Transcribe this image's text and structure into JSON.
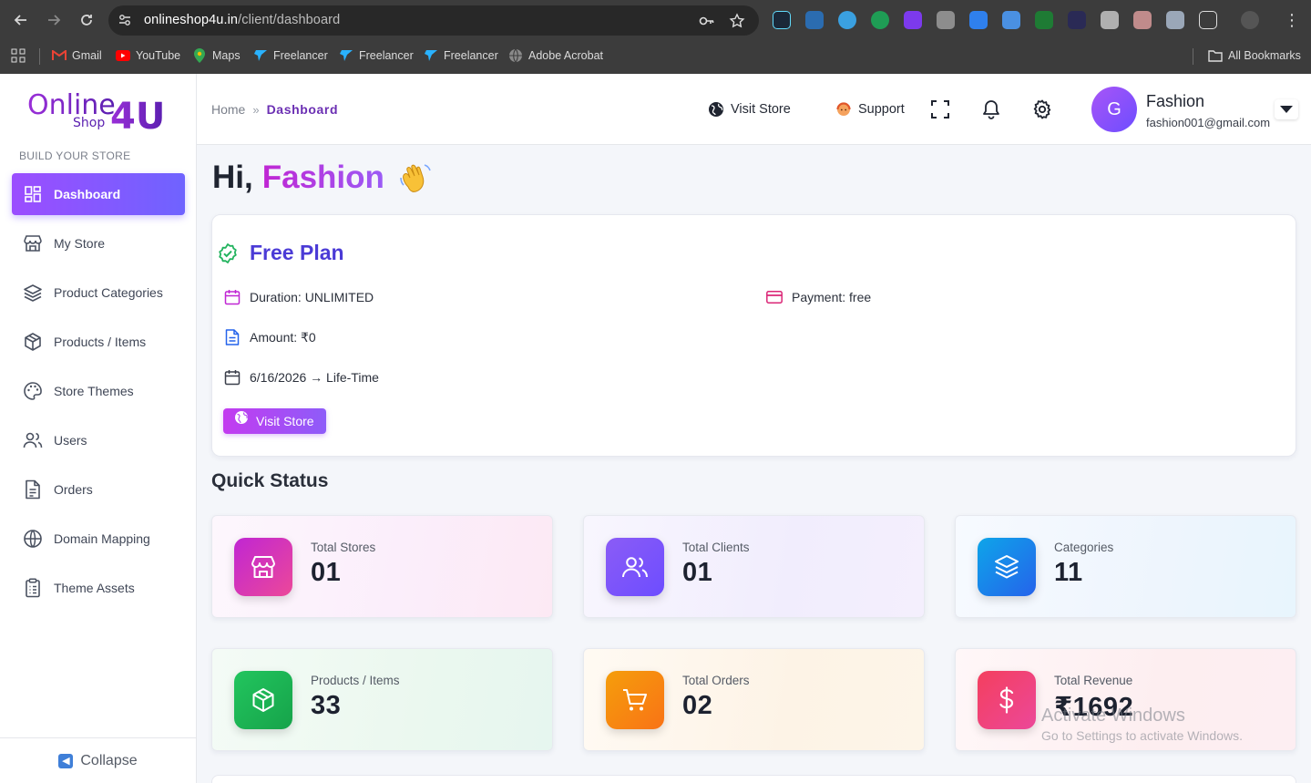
{
  "browser": {
    "url_host": "onlineshop4u.in",
    "url_path": "/client/dashboard",
    "bookmarks": [
      {
        "label": "Gmail",
        "icon": "gmail-icon"
      },
      {
        "label": "YouTube",
        "icon": "youtube-icon"
      },
      {
        "label": "Maps",
        "icon": "maps-icon"
      },
      {
        "label": "Freelancer",
        "icon": "freelancer-icon"
      },
      {
        "label": "Freelancer",
        "icon": "freelancer-icon"
      },
      {
        "label": "Freelancer",
        "icon": "freelancer-icon"
      },
      {
        "label": "Adobe Acrobat",
        "icon": "globe-icon"
      }
    ],
    "all_bookmarks": "All Bookmarks"
  },
  "brand": {
    "logo_main": "Online",
    "logo_sub": "Shop",
    "logo_accent": "4U",
    "color": "#7c2fd6"
  },
  "sidebar": {
    "section_label": "BUILD YOUR STORE",
    "items": [
      {
        "label": "Dashboard",
        "icon": "dashboard-icon",
        "active": true
      },
      {
        "label": "My Store",
        "icon": "store-icon"
      },
      {
        "label": "Product Categories",
        "icon": "layers-icon"
      },
      {
        "label": "Products / Items",
        "icon": "box-icon"
      },
      {
        "label": "Store Themes",
        "icon": "palette-icon"
      },
      {
        "label": "Users",
        "icon": "users-icon"
      },
      {
        "label": "Orders",
        "icon": "document-icon"
      },
      {
        "label": "Domain Mapping",
        "icon": "globe-icon"
      },
      {
        "label": "Theme Assets",
        "icon": "clipboard-icon"
      }
    ],
    "collapse_label": "Collapse"
  },
  "header": {
    "breadcrumb_home": "Home",
    "breadcrumb_current": "Dashboard",
    "visit_store": "Visit Store",
    "support": "Support",
    "user_initial": "G",
    "user_name": "Fashion",
    "user_email": "fashion001@gmail.com"
  },
  "main": {
    "greeting_prefix": "Hi,",
    "greeting_name": "Fashion",
    "plan": {
      "title": "Free Plan",
      "duration": "Duration: UNLIMITED",
      "payment": "Payment: free",
      "amount": "Amount: ₹0",
      "validity": "6/16/2026 → Life-Time",
      "button": "Visit Store"
    },
    "quick_status_title": "Quick Status",
    "stats": [
      {
        "label": "Total Stores",
        "value": "01",
        "icon": "store-icon",
        "color": "#d946ef"
      },
      {
        "label": "Total Clients",
        "value": "01",
        "icon": "users-icon",
        "color": "#8b5cf6"
      },
      {
        "label": "Categories",
        "value": "11",
        "icon": "layers-icon",
        "color": "#3b82f6"
      },
      {
        "label": "Products / Items",
        "value": "33",
        "icon": "box-icon",
        "color": "#22c55e"
      },
      {
        "label": "Total Orders",
        "value": "02",
        "icon": "cart-icon",
        "color": "#f97316"
      },
      {
        "label": "Total Revenue",
        "value": "₹1692",
        "icon": "dollar-icon",
        "color": "#f43f5e"
      }
    ]
  },
  "watermark": {
    "line1": "Activate Windows",
    "line2": "Go to Settings to activate Windows."
  }
}
